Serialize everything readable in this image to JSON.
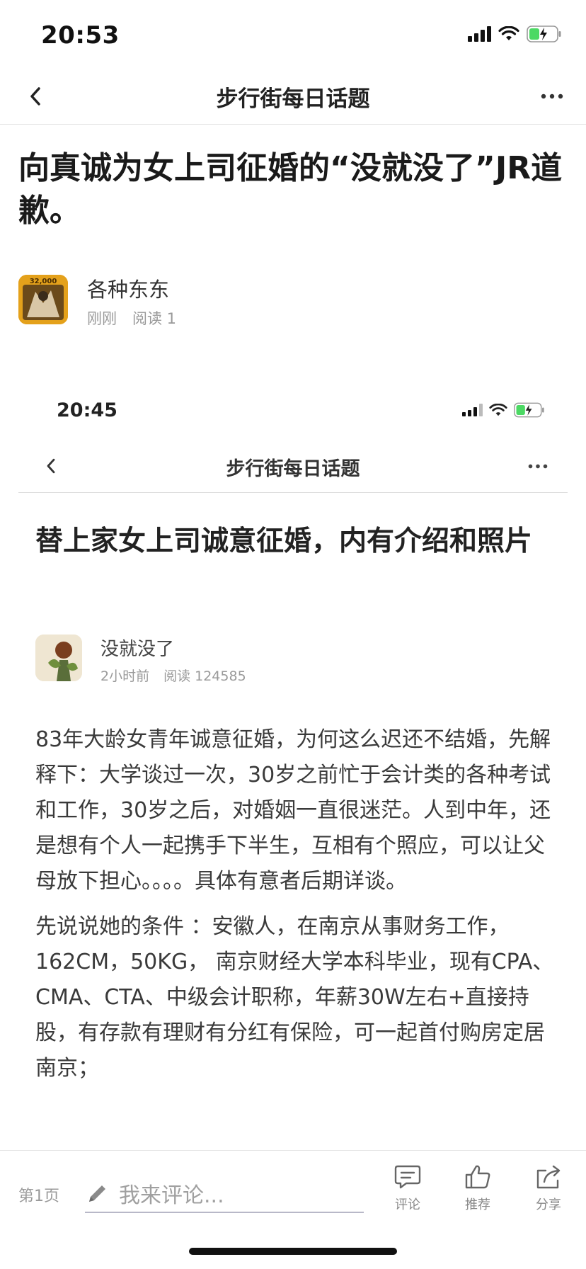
{
  "status_bar": {
    "time": "20:53"
  },
  "nav": {
    "title": "步行街每日话题"
  },
  "article": {
    "title": "向真诚为女上司征婚的“没就没了”JR道歉。",
    "author": "各种东东",
    "time": "刚刚",
    "reads": "阅读 1",
    "avatar_text": "32,000"
  },
  "embedded": {
    "time": "20:45",
    "nav_title": "步行街每日话题",
    "title": "替上家女上司诚意征婚，内有介绍和照片",
    "author": "没就没了",
    "time_ago": "2小时前",
    "reads": "阅读 124585",
    "paragraphs": [
      "83年大龄女青年诚意征婚，为何这么迟还不结婚，先解释下：大学谈过一次，30岁之前忙于会计类的各种考试和工作，30岁之后，对婚姻一直很迷茫。人到中年，还是想有个人一起携手下半生，互相有个照应，可以让父母放下担心。。。。具体有意者后期详谈。",
      "先说说她的条件 ：安徽人，在南京从事财务工作，162CM，50KG，  南京财经大学本科毕业，现有CPA、CMA、CTA、中级会计职称，年薪30W左右+直接持股，有存款有理财有分红有保险，可一起首付购房定居南京；"
    ]
  },
  "toolbar": {
    "page": "第1页",
    "comment_placeholder": "我来评论...",
    "comment_label": "评论",
    "recommend_label": "推荐",
    "share_label": "分享"
  }
}
